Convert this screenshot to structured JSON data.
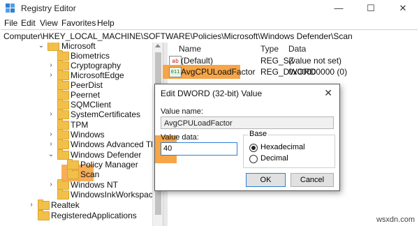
{
  "window": {
    "title": "Registry Editor",
    "min": "—",
    "max": "☐",
    "close": "✕"
  },
  "menu": [
    "File",
    "Edit",
    "View",
    "Favorites",
    "Help"
  ],
  "address": "Computer\\HKEY_LOCAL_MACHINE\\SOFTWARE\\Policies\\Microsoft\\Windows Defender\\Scan",
  "tree": {
    "microsoft": "Microsoft",
    "items": [
      "Biometrics",
      "Cryptography",
      "MicrosoftEdge",
      "PeerDist",
      "Peernet",
      "SQMClient",
      "SystemCertificates",
      "TPM",
      "Windows",
      "Windows Advanced Threat Pro",
      "Windows Defender",
      "Policy Manager",
      "Scan",
      "Windows NT",
      "WindowsInkWorkspace",
      "Realtek",
      "RegisteredApplications"
    ]
  },
  "list": {
    "headers": {
      "name": "Name",
      "type": "Type",
      "data": "Data"
    },
    "rows": [
      {
        "name": "(Default)",
        "type": "REG_SZ",
        "data": "(value not set)",
        "icon": "ab"
      },
      {
        "name": "AvgCPULoadFactor",
        "type": "REG_DWORD",
        "data": "0x00000000 (0)",
        "icon": "011"
      }
    ]
  },
  "dialog": {
    "title": "Edit DWORD (32-bit) Value",
    "close": "✕",
    "value_name_label": "Value name:",
    "value_name": "AvgCPULoadFactor",
    "value_data_label": "Value data:",
    "value_data": "40",
    "base_label": "Base",
    "hex_label": "Hexadecimal",
    "dec_label": "Decimal",
    "ok": "OK",
    "cancel": "Cancel"
  },
  "watermark": "wsxdn.com",
  "colors": {
    "highlight": "#f6a548",
    "folder": "#f2c04a",
    "accent": "#2e7fd6"
  }
}
